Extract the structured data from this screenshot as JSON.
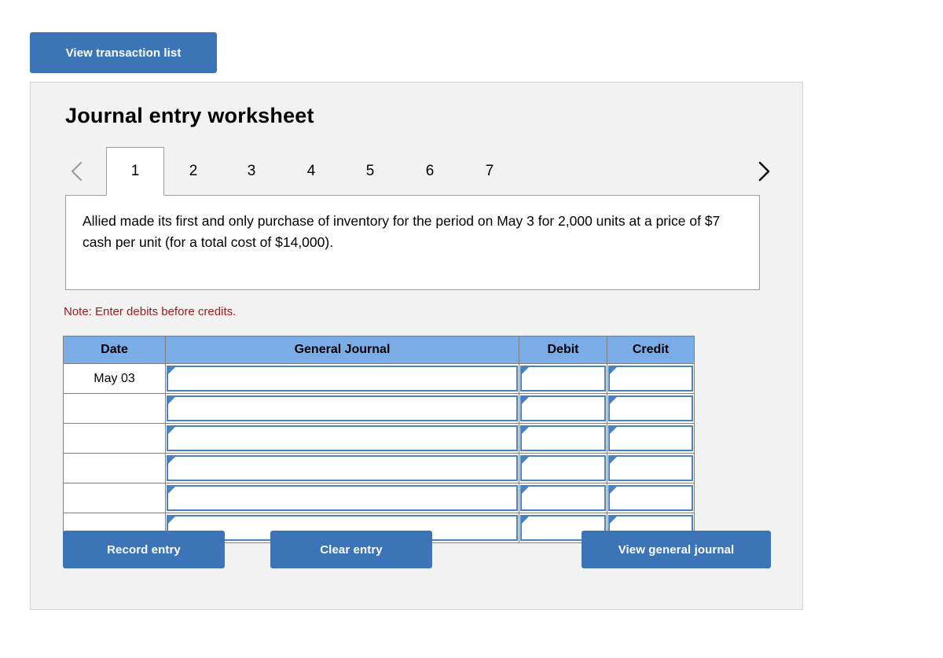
{
  "top": {
    "view_transaction_label": "View transaction list"
  },
  "panel": {
    "title": "Journal entry worksheet",
    "nav": {
      "prev_icon": "chevron-left-icon",
      "next_icon": "chevron-right-icon",
      "prev_enabled": false,
      "next_enabled": true
    },
    "tabs": [
      {
        "label": "1",
        "active": true
      },
      {
        "label": "2",
        "active": false
      },
      {
        "label": "3",
        "active": false
      },
      {
        "label": "4",
        "active": false
      },
      {
        "label": "5",
        "active": false
      },
      {
        "label": "6",
        "active": false
      },
      {
        "label": "7",
        "active": false
      }
    ],
    "prompt": "Allied made its first and only purchase of inventory for the period on May 3 for 2,000 units at a price of $7 cash per unit (for a total cost of $14,000).",
    "note": "Note: Enter debits before credits.",
    "table": {
      "headers": [
        "Date",
        "General Journal",
        "Debit",
        "Credit"
      ],
      "rows": [
        {
          "date": "May 03",
          "general_journal": "",
          "debit": "",
          "credit": ""
        },
        {
          "date": "",
          "general_journal": "",
          "debit": "",
          "credit": ""
        },
        {
          "date": "",
          "general_journal": "",
          "debit": "",
          "credit": ""
        },
        {
          "date": "",
          "general_journal": "",
          "debit": "",
          "credit": ""
        },
        {
          "date": "",
          "general_journal": "",
          "debit": "",
          "credit": ""
        },
        {
          "date": "",
          "general_journal": "",
          "debit": "",
          "credit": ""
        }
      ]
    },
    "actions": {
      "record_label": "Record entry",
      "clear_label": "Clear entry",
      "view_journal_label": "View general journal"
    }
  },
  "colors": {
    "button_blue": "#3b75b8",
    "header_blue": "#7aace8",
    "cell_border_blue": "#4a81bf",
    "panel_background": "#f2f2f2",
    "note_red": "#9b1b1b"
  }
}
